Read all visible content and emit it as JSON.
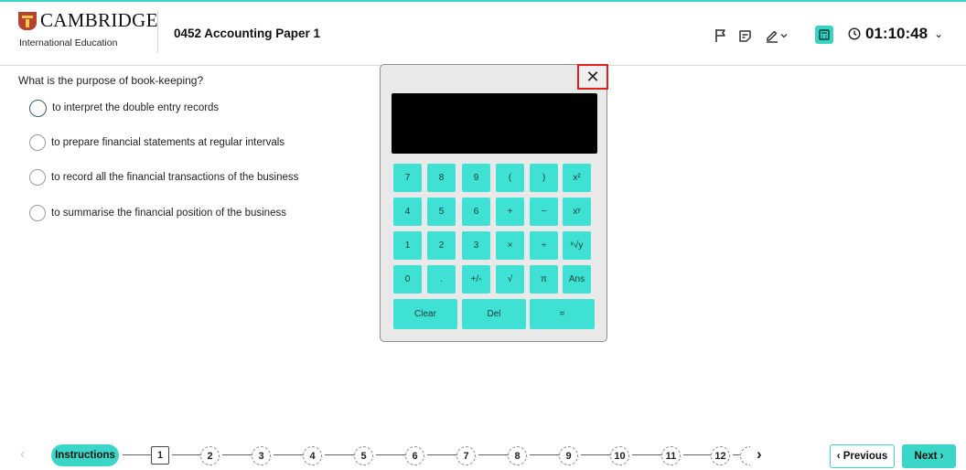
{
  "header": {
    "brand": "CAMBRIDGE",
    "brand_sub": "International Education",
    "paper_title": "0452 Accounting Paper 1",
    "timer": "01:10:48",
    "accent_color": "#3ad7c8"
  },
  "question": {
    "text": "What is the purpose of book-keeping?",
    "options": [
      "to interpret the double entry records",
      "to prepare financial statements at regular intervals",
      "to record all the financial transactions of the business",
      "to summarise the financial position of the business"
    ]
  },
  "calculator": {
    "close_glyph": "✕",
    "rows": [
      [
        "7",
        "8",
        "9",
        "(",
        ")",
        "x²"
      ],
      [
        "4",
        "5",
        "6",
        "+",
        "−",
        "xʸ"
      ],
      [
        "1",
        "2",
        "3",
        "×",
        "÷",
        "ˣ√y"
      ],
      [
        "0",
        ".",
        "+/-",
        "√",
        "π",
        "Ans"
      ]
    ],
    "clear_label": "Clear",
    "del_label": "Del",
    "equals_label": "="
  },
  "footer": {
    "instructions_label": "Instructions",
    "question_numbers": [
      "1",
      "2",
      "3",
      "4",
      "5",
      "6",
      "7",
      "8",
      "9",
      "10",
      "11",
      "12"
    ],
    "current_question": "1",
    "previous_label": "‹ Previous",
    "next_label": "Next ›"
  }
}
